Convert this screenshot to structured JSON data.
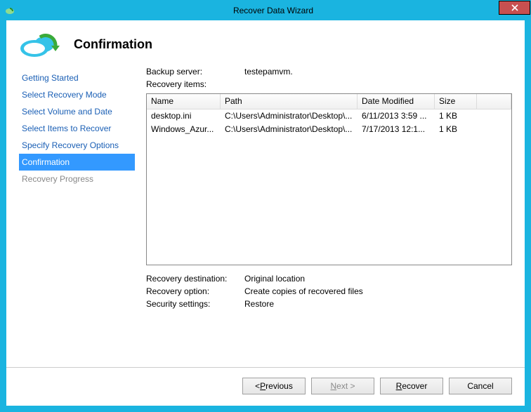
{
  "window": {
    "title": "Recover Data Wizard"
  },
  "page": {
    "heading": "Confirmation"
  },
  "nav": {
    "items": [
      {
        "label": "Getting Started",
        "state": "link"
      },
      {
        "label": "Select Recovery Mode",
        "state": "link"
      },
      {
        "label": "Select Volume and Date",
        "state": "link"
      },
      {
        "label": "Select Items to Recover",
        "state": "link"
      },
      {
        "label": "Specify Recovery Options",
        "state": "link"
      },
      {
        "label": "Confirmation",
        "state": "selected"
      },
      {
        "label": "Recovery Progress",
        "state": "disabled"
      }
    ]
  },
  "backup_server": {
    "label": "Backup server:",
    "value": "testepamvm."
  },
  "recovery_items_label": "Recovery items:",
  "grid": {
    "columns": {
      "name": "Name",
      "path": "Path",
      "date": "Date Modified",
      "size": "Size"
    },
    "rows": [
      {
        "name": "desktop.ini",
        "path": "C:\\Users\\Administrator\\Desktop\\...",
        "date": "6/11/2013 3:59 ...",
        "size": "1 KB"
      },
      {
        "name": "Windows_Azur...",
        "path": "C:\\Users\\Administrator\\Desktop\\...",
        "date": "7/17/2013 12:1...",
        "size": "1 KB"
      }
    ]
  },
  "dest": {
    "label": "Recovery destination:",
    "value": "Original location"
  },
  "option": {
    "label": "Recovery option:",
    "value": "Create copies of recovered files"
  },
  "sec": {
    "label": "Security settings:",
    "value": "Restore"
  },
  "buttons": {
    "previous_pre": "< ",
    "previous_accel": "P",
    "previous_post": "revious",
    "next_accel": "N",
    "next_post": "ext >",
    "recover_accel": "R",
    "recover_post": "ecover",
    "cancel": "Cancel"
  }
}
